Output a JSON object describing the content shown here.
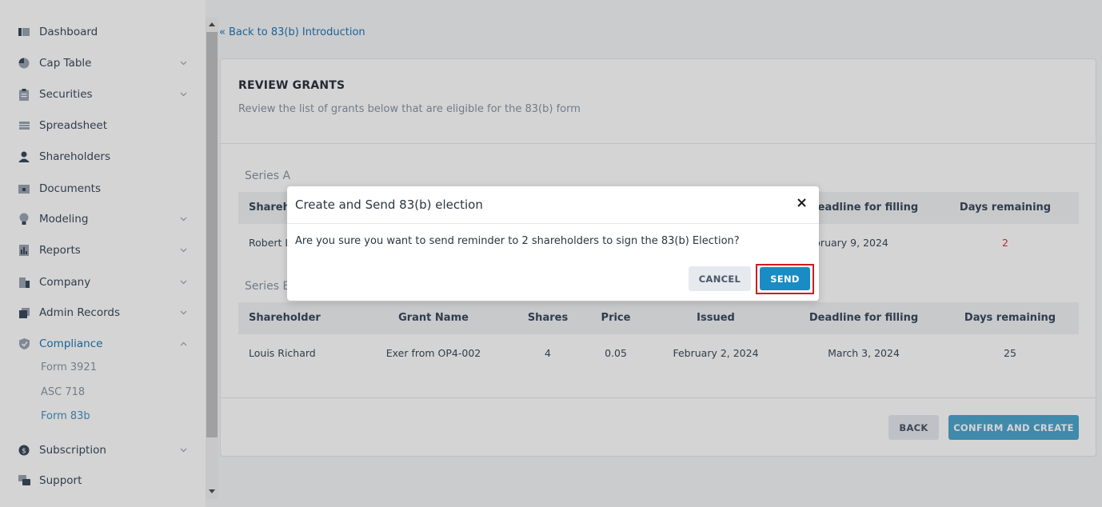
{
  "sidebar": {
    "items": [
      {
        "label": "Dashboard",
        "icon": "dashboard-icon",
        "has_chevron": false
      },
      {
        "label": "Cap Table",
        "icon": "pie-chart-icon",
        "has_chevron": true
      },
      {
        "label": "Securities",
        "icon": "clipboard-icon",
        "has_chevron": true
      },
      {
        "label": "Spreadsheet",
        "icon": "spreadsheet-icon",
        "has_chevron": false
      },
      {
        "label": "Shareholders",
        "icon": "user-icon",
        "has_chevron": false
      },
      {
        "label": "Documents",
        "icon": "folder-icon",
        "has_chevron": false
      },
      {
        "label": "Modeling",
        "icon": "lightbulb-icon",
        "has_chevron": true
      },
      {
        "label": "Reports",
        "icon": "report-icon",
        "has_chevron": true
      },
      {
        "label": "Company",
        "icon": "building-icon",
        "has_chevron": true
      },
      {
        "label": "Admin Records",
        "icon": "admin-records-icon",
        "has_chevron": true
      },
      {
        "label": "Compliance",
        "icon": "shield-check-icon",
        "has_chevron": true,
        "expanded": true,
        "active": true
      },
      {
        "label": "Subscription",
        "icon": "dollar-icon",
        "has_chevron": true
      },
      {
        "label": "Support",
        "icon": "support-icon",
        "has_chevron": false
      }
    ],
    "compliance_sub": [
      {
        "label": "Form 3921",
        "active": false
      },
      {
        "label": "ASC 718",
        "active": false
      },
      {
        "label": "Form 83b",
        "active": true
      }
    ]
  },
  "back_link": {
    "icon": "double-chevron-left-icon",
    "label": "Back to 83(b) Introduction"
  },
  "card": {
    "title": "REVIEW GRANTS",
    "subtitle": "Review the list of grants below that are eligible for the 83(b) form"
  },
  "series_a": {
    "label": "Series A",
    "columns": [
      "Shareholder",
      "Deadline for filling",
      "Days remaining"
    ],
    "visible_fragments": {
      "shareholder_header": "Shareho",
      "shareholder": "Robert L",
      "deadline": "bruary 9, 2024",
      "days_remaining": "2"
    }
  },
  "series_b": {
    "label": "Series B",
    "label_visible": "Series E",
    "columns": [
      "Shareholder",
      "Grant Name",
      "Shares",
      "Price",
      "Issued",
      "Deadline for filling",
      "Days remaining"
    ],
    "rows": [
      {
        "shareholder": "Louis Richard",
        "grant_name": "Exer from OP4-002",
        "shares": "4",
        "price": "0.05",
        "issued": "February 2, 2024",
        "deadline": "March 3, 2024",
        "days_remaining": "25"
      }
    ]
  },
  "footer": {
    "back_label": "BACK",
    "confirm_label": "CONFIRM AND CREATE"
  },
  "modal": {
    "title": "Create and Send 83(b) election",
    "close_icon": "close-icon",
    "body": "Are you sure you want to send reminder to 2 shareholders to sign the 83(b) Election?",
    "cancel_label": "CANCEL",
    "send_label": "SEND"
  },
  "colors": {
    "accent": "#1f78b4",
    "send_button": "#1a8cc5",
    "confirm_button": "#4da6cf",
    "danger": "#e03131",
    "highlight_border": "#d0191f"
  }
}
